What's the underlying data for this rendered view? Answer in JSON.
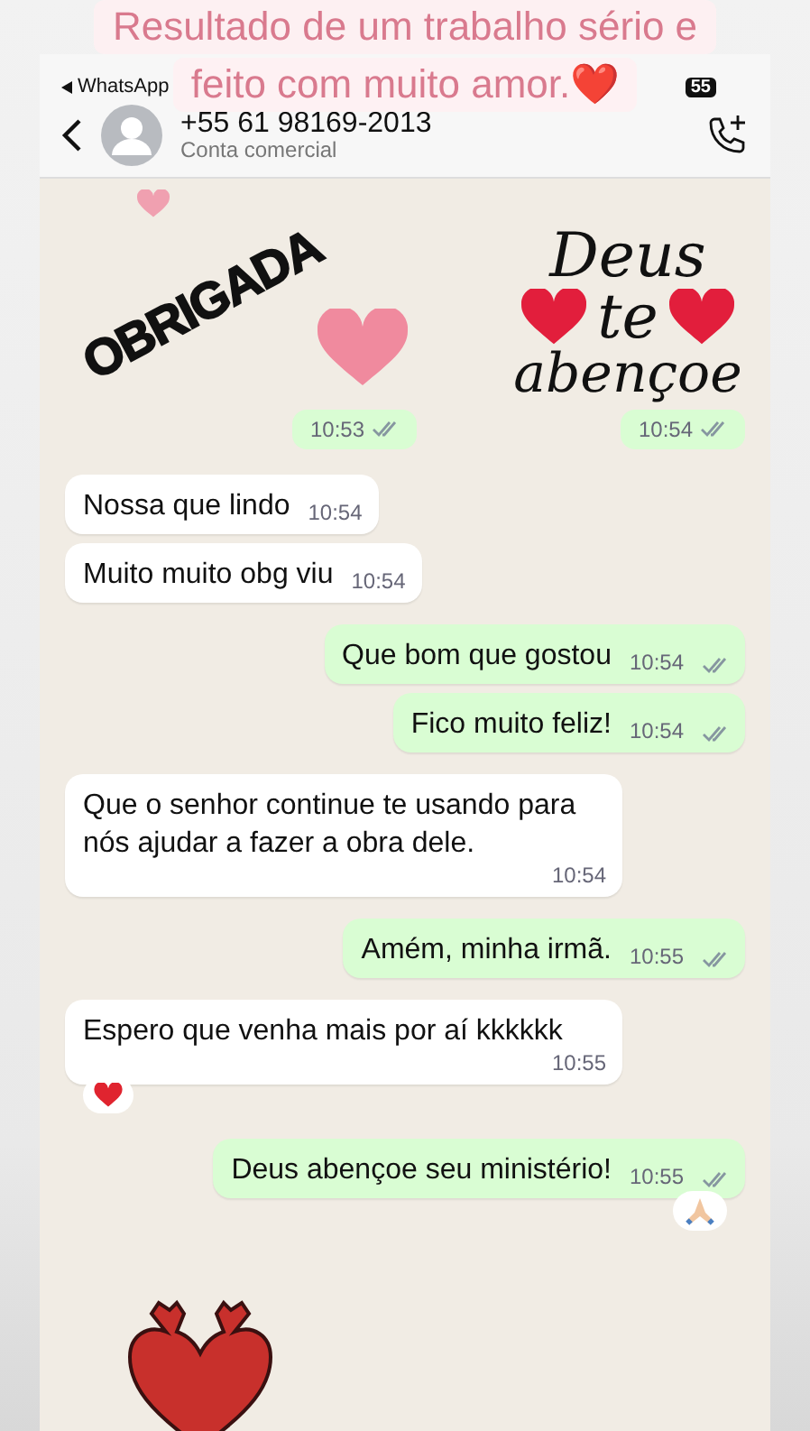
{
  "caption": [
    "Resultado de um trabalho sério e",
    "feito com muito amor.❤️"
  ],
  "status_bar": {
    "back_app": "WhatsApp",
    "battery": "55"
  },
  "header": {
    "title": "+55 61 98169-2013",
    "subtitle": "Conta comercial"
  },
  "stickers": [
    {
      "kind": "obrigada",
      "text": "OBRIGADA",
      "time": "10:53",
      "read": false
    },
    {
      "kind": "blessing",
      "lines": [
        "Deus",
        "te",
        "abençoe"
      ],
      "time": "10:54",
      "read": false
    }
  ],
  "messages": [
    {
      "kind": "in",
      "text": "Nossa que lindo",
      "time": "10:54"
    },
    {
      "kind": "in",
      "text": "Muito muito obg viu",
      "time": "10:54"
    },
    {
      "kind": "out",
      "text": "Que bom que gostou",
      "time": "10:54",
      "read": false
    },
    {
      "kind": "out",
      "text": "Fico muito feliz!",
      "time": "10:54",
      "read": false
    },
    {
      "kind": "in",
      "text": "Que o senhor continue te usando para nós ajudar a fazer a obra dele.",
      "time": "10:54"
    },
    {
      "kind": "out",
      "text": "Amém, minha irmã.",
      "time": "10:55",
      "read": false
    },
    {
      "kind": "in",
      "text": "Espero que venha mais por aí kkkkkk",
      "time": "10:55",
      "reaction": {
        "kind": "heart"
      }
    },
    {
      "kind": "out",
      "text": "Deus abençoe seu ministério!",
      "time": "10:55",
      "read": false,
      "reaction": {
        "kind": "pray"
      }
    }
  ]
}
